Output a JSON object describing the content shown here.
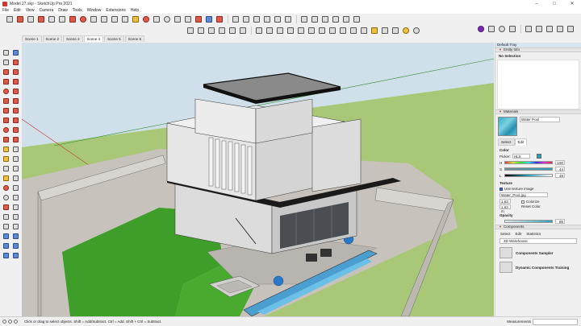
{
  "window": {
    "title": "Model 27.skp - SketchUp Pro 2021"
  },
  "menu": [
    "File",
    "Edit",
    "View",
    "Camera",
    "Draw",
    "Tools",
    "Window",
    "Extensions",
    "Help"
  ],
  "scenes": [
    "Scene 1",
    "Scene 2",
    "Scene 3",
    "Scene 4",
    "Scene 5",
    "Scene 6"
  ],
  "active_scene": "Scene 4",
  "tray": {
    "title": "Default Tray",
    "entity_info": {
      "header": "Entity Info",
      "selection": "No Selection"
    },
    "materials": {
      "header": "Materials",
      "name": "Water Pool",
      "tabs": [
        "Select",
        "Edit"
      ],
      "color_label": "Color",
      "picker_label": "Picker:",
      "picker_value": "HLS",
      "sliders": [
        {
          "label": "H",
          "value": "190"
        },
        {
          "label": "S",
          "value": "44"
        },
        {
          "label": "L",
          "value": "48"
        }
      ],
      "texture_label": "Texture",
      "use_texture_label": "Use texture image",
      "texture_file": "Water_Pool.jpg",
      "width": "1,63 m",
      "height": "1,63 m",
      "colorize_label": "Colorize",
      "reset_label": "Reset Color",
      "opacity_label": "Opacity",
      "opacity_value": "85",
      "accent_color": "#2aa0b8"
    },
    "components": {
      "header": "Components",
      "tabs": [
        "Select",
        "Edit",
        "Statistics"
      ],
      "search_placeholder": "3D Warehouse",
      "items": [
        "Components Sampler",
        "Dynamic Components Training"
      ]
    }
  },
  "status": {
    "hint": "Click or drag to select objects. Shift = Add/Subtract. Ctrl = Add. Shift + Ctrl = Subtract.",
    "measurements_label": "Measurements"
  },
  "colors": {
    "sky": "#cfe0ea",
    "ground": "#a8c878",
    "grass": "#3f9e2a",
    "pool": "#4a9fd0",
    "building": "#e8e8e8"
  }
}
